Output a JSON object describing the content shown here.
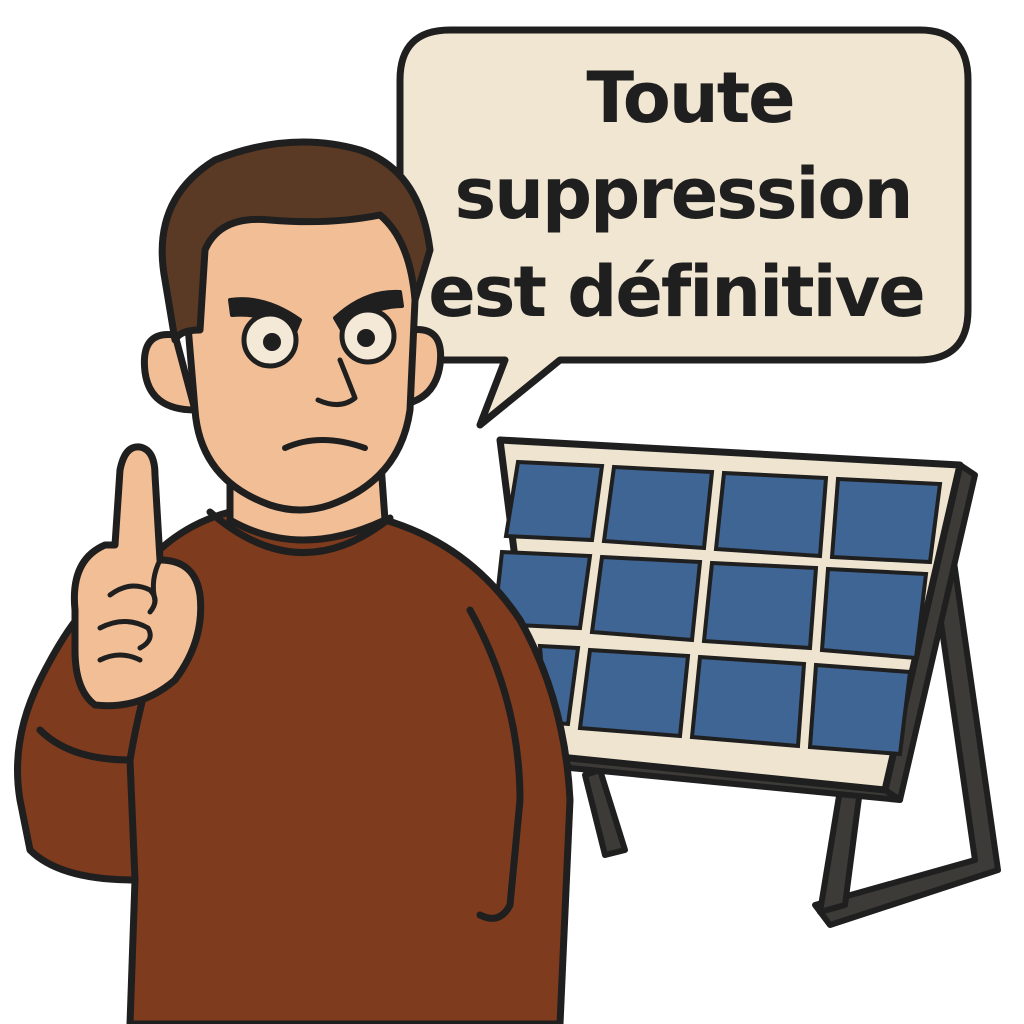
{
  "speech_bubble": {
    "lines": [
      "Toute",
      "suppression",
      "est définitive"
    ]
  },
  "colors": {
    "background": "#ffffff",
    "outline": "#1f1f1f",
    "bubble_fill": "#f1e6d2",
    "skin": "#f2be96",
    "hair": "#5a3a24",
    "sweater": "#7f3b1d",
    "panel_frame": "#efe4cf",
    "panel_cell": "#3f6594",
    "stand": "#3d3b38"
  },
  "icons": {
    "character": "man-pointing-finger",
    "object": "solar-panel"
  }
}
